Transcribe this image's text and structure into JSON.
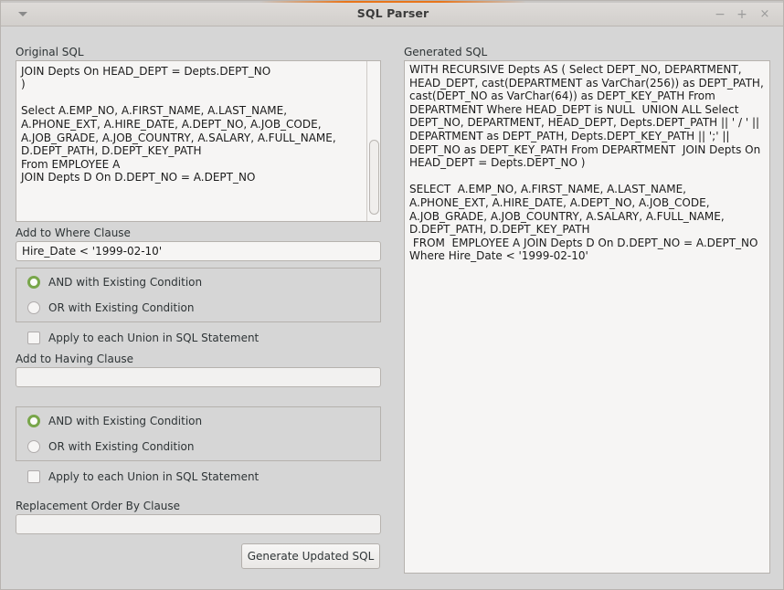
{
  "window": {
    "title": "SQL Parser",
    "menu_icon": "chevron-down-icon",
    "controls": {
      "minimize": "−",
      "maximize": "+",
      "close": "×"
    }
  },
  "original_sql": {
    "label": "Original SQL",
    "value": "From DEPARTMENT\nJOIN Depts On HEAD_DEPT = Depts.DEPT_NO\n)\n\nSelect A.EMP_NO, A.FIRST_NAME, A.LAST_NAME,\nA.PHONE_EXT, A.HIRE_DATE, A.DEPT_NO, A.JOB_CODE,\nA.JOB_GRADE, A.JOB_COUNTRY, A.SALARY, A.FULL_NAME,\nD.DEPT_PATH, D.DEPT_KEY_PATH\nFrom EMPLOYEE A\nJOIN Depts D On D.DEPT_NO = A.DEPT_NO"
  },
  "generated_sql": {
    "label": "Generated SQL",
    "value": "WITH RECURSIVE Depts AS ( Select DEPT_NO, DEPARTMENT, HEAD_DEPT, cast(DEPARTMENT as VarChar(256)) as DEPT_PATH, cast(DEPT_NO as VarChar(64)) as DEPT_KEY_PATH From DEPARTMENT Where HEAD_DEPT is NULL  UNION ALL Select DEPT_NO, DEPARTMENT, HEAD_DEPT, Depts.DEPT_PATH || ' / ' || DEPARTMENT as DEPT_PATH, Depts.DEPT_KEY_PATH || ';' || DEPT_NO as DEPT_KEY_PATH From DEPARTMENT  JOIN Depts On HEAD_DEPT = Depts.DEPT_NO )\n\nSELECT  A.EMP_NO, A.FIRST_NAME, A.LAST_NAME, A.PHONE_EXT, A.HIRE_DATE, A.DEPT_NO, A.JOB_CODE, A.JOB_GRADE, A.JOB_COUNTRY, A.SALARY, A.FULL_NAME, D.DEPT_PATH, D.DEPT_KEY_PATH\n FROM  EMPLOYEE A JOIN Depts D On D.DEPT_NO = A.DEPT_NO\nWhere Hire_Date < '1999-02-10'"
  },
  "where_clause": {
    "label": "Add to Where Clause",
    "value": "Hire_Date < '1999-02-10'",
    "placeholder": "",
    "radio_and": "AND with Existing Condition",
    "radio_or": "OR with Existing Condition",
    "selected": "and",
    "union_checkbox": "Apply to each Union in SQL Statement",
    "union_checked": false
  },
  "having_clause": {
    "label": "Add to Having Clause",
    "value": "",
    "placeholder": "",
    "radio_and": "AND with Existing Condition",
    "radio_or": "OR with Existing Condition",
    "selected": "and",
    "union_checkbox": "Apply to each Union in SQL Statement",
    "union_checked": false
  },
  "order_by": {
    "label": "Replacement Order By Clause",
    "value": "",
    "placeholder": ""
  },
  "actions": {
    "generate_button": "Generate Updated SQL"
  },
  "colors": {
    "accent": "#e8751a",
    "radio_selected": "#78a64a",
    "window_bg": "#d6d6d6",
    "field_bg": "#f6f5f4"
  }
}
